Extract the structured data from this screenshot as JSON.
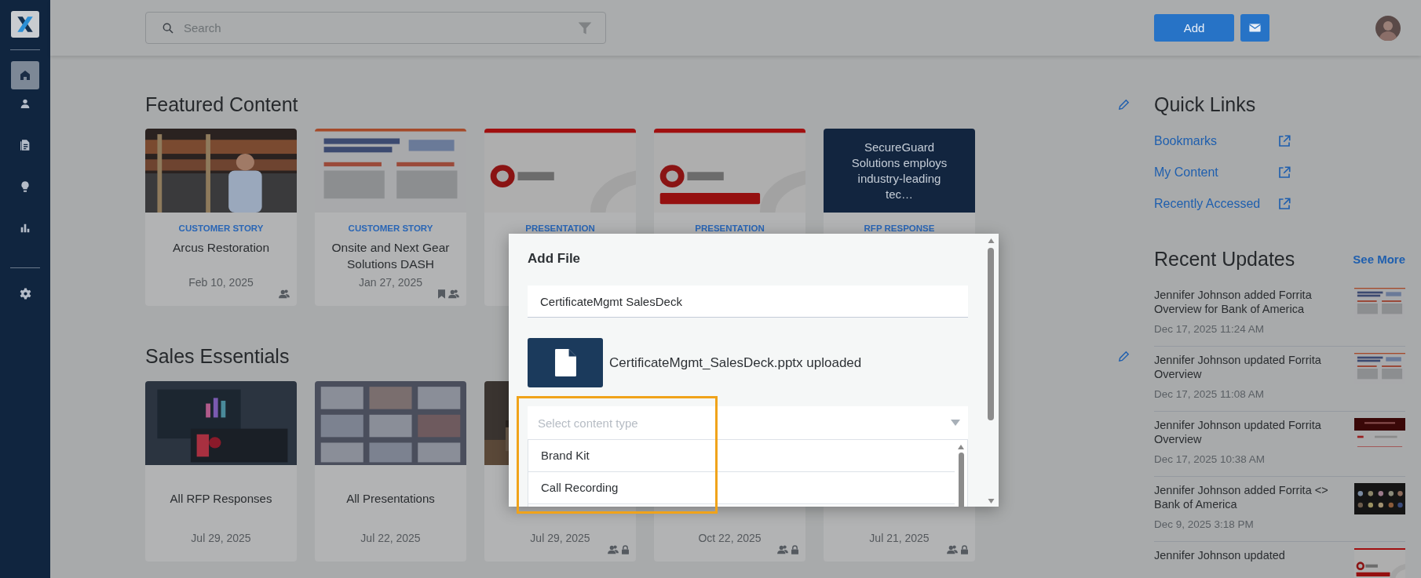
{
  "sidebar": {
    "items": [
      {
        "selected": true
      },
      {
        "selected": false
      },
      {
        "selected": false
      },
      {
        "selected": false
      },
      {
        "selected": false
      }
    ],
    "settings": {
      "selected": false
    }
  },
  "search": {
    "placeholder": "Search"
  },
  "header_actions": {
    "add_button": "Add"
  },
  "featured": {
    "title": "Featured Content",
    "cards": [
      {
        "category": "CUSTOMER STORY",
        "title": "Arcus Restoration",
        "date": "Feb 10, 2025",
        "bookmarked": false,
        "shared": true
      },
      {
        "category": "CUSTOMER STORY",
        "title": "Onsite and Next Gear Solutions DASH",
        "date": "Jan 27, 2025",
        "bookmarked": true,
        "shared": true
      },
      {
        "category": "PRESENTATION"
      },
      {
        "category": "PRESENTATION"
      },
      {
        "thumb": {
          "kind": "text",
          "text": "SecureGuard Solutions employs industry-leading tec…"
        },
        "category": "RFP RESPONSE"
      }
    ]
  },
  "sales_essentials": {
    "title": "Sales Essentials",
    "cards": [
      {
        "title": "All RFP Responses",
        "date": "Jul 29, 2025",
        "shared": false,
        "locked": false
      },
      {
        "title": "All Presentations",
        "date": "Jul 22, 2025",
        "shared": false,
        "locked": false
      },
      {
        "date": "Jul 29, 2025",
        "shared": true,
        "locked": true
      },
      {
        "date": "Oct 22, 2025",
        "shared": true,
        "locked": true
      },
      {
        "date": "Jul 21, 2025",
        "shared": true,
        "locked": true
      }
    ]
  },
  "quick_links": {
    "title": "Quick Links",
    "links": [
      "Bookmarks",
      "My Content",
      "Recently Accessed"
    ]
  },
  "recent_updates": {
    "title": "Recent Updates",
    "see_more": "See More",
    "items": [
      {
        "text": "Jennifer Johnson added Forrita Overview for Bank of America",
        "time": "Dec 17, 2025 11:24 AM"
      },
      {
        "text": "Jennifer Johnson updated Forrita Overview",
        "time": "Dec 17, 2025 11:08 AM"
      },
      {
        "text": "Jennifer Johnson updated Forrita Overview",
        "time": "Dec 17, 2025 10:38 AM"
      },
      {
        "text": "Jennifer Johnson added Forrita <> Bank of America",
        "time": "Dec 9, 2025 3:18 PM"
      },
      {
        "text": "Jennifer Johnson updated"
      }
    ]
  },
  "modal": {
    "title": "Add File",
    "name_field": {
      "value": "CertificateMgmt SalesDeck"
    },
    "upload_status": "CertificateMgmt_SalesDeck.pptx uploaded",
    "content_type": {
      "placeholder": "Select content type",
      "expanded": true,
      "options": [
        "Brand Kit",
        "Call Recording"
      ]
    },
    "highlight": true
  }
}
